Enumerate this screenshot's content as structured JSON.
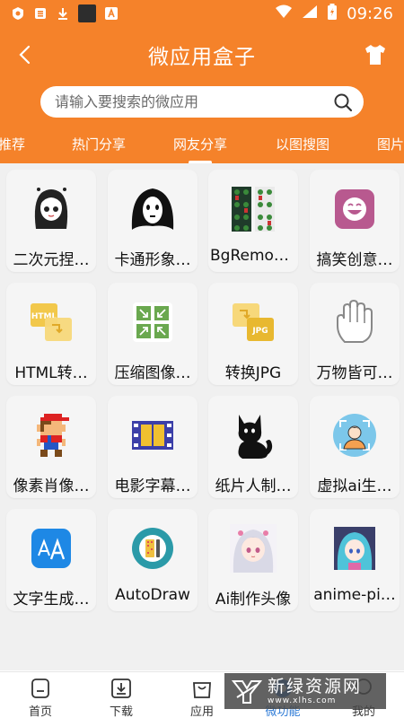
{
  "status_bar": {
    "time": "09:26"
  },
  "header": {
    "title": "微应用盒子",
    "search_placeholder": "请输入要搜索的微应用"
  },
  "tabs": [
    {
      "label": "推荐"
    },
    {
      "label": "热门分享"
    },
    {
      "label": "网友分享"
    },
    {
      "label": "以图搜图"
    },
    {
      "label": "图片"
    }
  ],
  "apps": [
    {
      "label": "二次元捏…",
      "icon": "anime-girl-icon"
    },
    {
      "label": "卡通形象…",
      "icon": "cartoon-ghost-icon"
    },
    {
      "label": "BgRemov…",
      "icon": "bg-remove-icon"
    },
    {
      "label": "搞笑创意…",
      "icon": "laughing-face-icon"
    },
    {
      "label": "HTML转…",
      "icon": "html-convert-icon"
    },
    {
      "label": "压缩图像…",
      "icon": "compress-image-icon"
    },
    {
      "label": "转换JPG",
      "icon": "jpg-convert-icon"
    },
    {
      "label": "万物皆可…",
      "icon": "hand-icon"
    },
    {
      "label": "像素肖像…",
      "icon": "pixel-mario-icon"
    },
    {
      "label": "电影字幕…",
      "icon": "film-strip-icon"
    },
    {
      "label": "纸片人制…",
      "icon": "black-cat-icon"
    },
    {
      "label": "虚拟ai生…",
      "icon": "ai-avatar-icon"
    },
    {
      "label": "文字生成…",
      "icon": "text-font-icon"
    },
    {
      "label": "AutoDraw",
      "icon": "autodraw-icon"
    },
    {
      "label": "Ai制作头像",
      "icon": "ai-portrait-icon"
    },
    {
      "label": "anime-pi…",
      "icon": "anime-picture-icon"
    }
  ],
  "app_icon_text": {
    "html": "HTML",
    "jpg": "JPG"
  },
  "bottom_nav": [
    {
      "label": "首页"
    },
    {
      "label": "下载"
    },
    {
      "label": "应用"
    },
    {
      "label": "微功能"
    },
    {
      "label": "我的"
    }
  ],
  "watermark": {
    "cn": "新绿资源网",
    "url": "www.xlhs.com"
  },
  "colors": {
    "brand": "#f5822a",
    "active_nav": "#2e7bd6"
  }
}
